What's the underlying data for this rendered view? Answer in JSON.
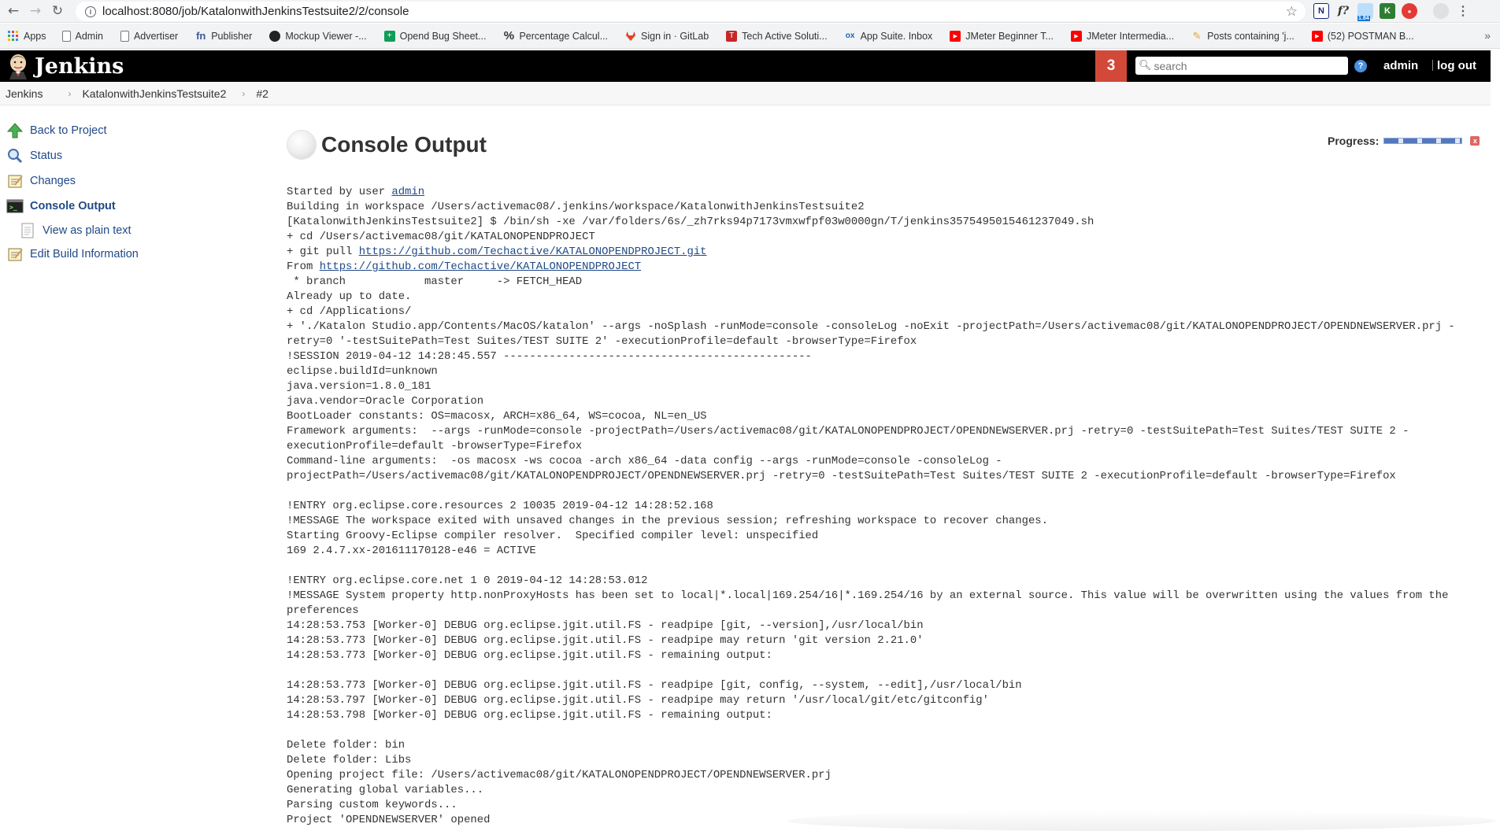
{
  "browser": {
    "url": "localhost:8080/job/KatalonwithJenkinsTestsuite2/2/console",
    "ext_badge": "1.84",
    "bookmarks": [
      {
        "label": "Apps",
        "icon": "apps-grid-icon",
        "color": "#4285f4"
      },
      {
        "label": "Admin",
        "icon": "page-icon",
        "color": "#9e9e9e"
      },
      {
        "label": "Advertiser",
        "icon": "page-icon",
        "color": "#9e9e9e"
      },
      {
        "label": "Publisher",
        "icon": "fn-icon",
        "color": "#3b5998"
      },
      {
        "label": "Mockup Viewer -...",
        "icon": "mockup-icon",
        "color": "#222222"
      },
      {
        "label": "Opend Bug Sheet...",
        "icon": "sheets-icon",
        "color": "#0f9d58"
      },
      {
        "label": "Percentage Calcul...",
        "icon": "percent-icon",
        "color": "#333333"
      },
      {
        "label": "Sign in · GitLab",
        "icon": "gitlab-icon",
        "color": "#e24329"
      },
      {
        "label": "Tech Active Soluti...",
        "icon": "techactive-icon",
        "color": "#c62828"
      },
      {
        "label": "App Suite. Inbox",
        "icon": "ox-icon",
        "color": "#1565c0"
      },
      {
        "label": "JMeter Beginner T...",
        "icon": "youtube-icon",
        "color": "#ff0000"
      },
      {
        "label": "JMeter Intermedia...",
        "icon": "youtube-icon",
        "color": "#ff0000"
      },
      {
        "label": "Posts containing 'j...",
        "icon": "posts-icon",
        "color": "#e8a33a"
      },
      {
        "label": "(52) POSTMAN B...",
        "icon": "youtube-icon",
        "color": "#ff0000"
      }
    ],
    "more": "»"
  },
  "header": {
    "title": "Jenkins",
    "notification_count": "3",
    "search_placeholder": "search",
    "help": "?",
    "user": "admin",
    "logout": "log out"
  },
  "breadcrumb": [
    "Jenkins",
    "KatalonwithJenkinsTestsuite2",
    "#2"
  ],
  "sidebar": [
    {
      "label": "Back to Project",
      "icon": "up-arrow-icon"
    },
    {
      "label": "Status",
      "icon": "magnifier-icon"
    },
    {
      "label": "Changes",
      "icon": "notepad-icon"
    },
    {
      "label": "Console Output",
      "icon": "terminal-icon",
      "active": true
    },
    {
      "label": "View as plain text",
      "icon": "document-icon",
      "sub": true
    },
    {
      "label": "Edit Build Information",
      "icon": "notepad-icon"
    }
  ],
  "main": {
    "title": "Console Output",
    "progress_label": "Progress:",
    "stop": "x"
  },
  "console": {
    "started_by": "Started by user ",
    "started_user": "admin",
    "lines_a": [
      "Building in workspace /Users/activemac08/.jenkins/workspace/KatalonwithJenkinsTestsuite2",
      "[KatalonwithJenkinsTestsuite2] $ /bin/sh -xe /var/folders/6s/_zh7rks94p7173vmxwfpf03w0000gn/T/jenkins3575495015461237049.sh",
      "+ cd /Users/activemac08/git/KATALONOPENDPROJECT"
    ],
    "git_pull_prefix": "+ git pull ",
    "git_pull_url": "https://github.com/Techactive/KATALONOPENDPROJECT.git",
    "from_prefix": "From ",
    "from_url": "https://github.com/Techactive/KATALONOPENDPROJECT",
    "lines_b": [
      " * branch            master     -> FETCH_HEAD",
      "Already up to date.",
      "+ cd /Applications/",
      "+ './Katalon Studio.app/Contents/MacOS/katalon' --args -noSplash -runMode=console -consoleLog -noExit -projectPath=/Users/activemac08/git/KATALONOPENDPROJECT/OPENDNEWSERVER.prj -",
      "retry=0 '-testSuitePath=Test Suites/TEST SUITE 2' -executionProfile=default -browserType=Firefox",
      "!SESSION 2019-04-12 14:28:45.557 -----------------------------------------------",
      "eclipse.buildId=unknown",
      "java.version=1.8.0_181",
      "java.vendor=Oracle Corporation",
      "BootLoader constants: OS=macosx, ARCH=x86_64, WS=cocoa, NL=en_US",
      "Framework arguments:  --args -runMode=console -projectPath=/Users/activemac08/git/KATALONOPENDPROJECT/OPENDNEWSERVER.prj -retry=0 -testSuitePath=Test Suites/TEST SUITE 2 -",
      "executionProfile=default -browserType=Firefox",
      "Command-line arguments:  -os macosx -ws cocoa -arch x86_64 -data config --args -runMode=console -consoleLog -",
      "projectPath=/Users/activemac08/git/KATALONOPENDPROJECT/OPENDNEWSERVER.prj -retry=0 -testSuitePath=Test Suites/TEST SUITE 2 -executionProfile=default -browserType=Firefox",
      "",
      "!ENTRY org.eclipse.core.resources 2 10035 2019-04-12 14:28:52.168",
      "!MESSAGE The workspace exited with unsaved changes in the previous session; refreshing workspace to recover changes.",
      "Starting Groovy-Eclipse compiler resolver.  Specified compiler level: unspecified",
      "169 2.4.7.xx-201611170128-e46 = ACTIVE",
      "",
      "!ENTRY org.eclipse.core.net 1 0 2019-04-12 14:28:53.012",
      "!MESSAGE System property http.nonProxyHosts has been set to local|*.local|169.254/16|*.169.254/16 by an external source. This value will be overwritten using the values from the",
      "preferences",
      "14:28:53.753 [Worker-0] DEBUG org.eclipse.jgit.util.FS - readpipe [git, --version],/usr/local/bin",
      "14:28:53.773 [Worker-0] DEBUG org.eclipse.jgit.util.FS - readpipe may return 'git version 2.21.0'",
      "14:28:53.773 [Worker-0] DEBUG org.eclipse.jgit.util.FS - remaining output:",
      "",
      "14:28:53.773 [Worker-0] DEBUG org.eclipse.jgit.util.FS - readpipe [git, config, --system, --edit],/usr/local/bin",
      "14:28:53.797 [Worker-0] DEBUG org.eclipse.jgit.util.FS - readpipe may return '/usr/local/git/etc/gitconfig'",
      "14:28:53.798 [Worker-0] DEBUG org.eclipse.jgit.util.FS - remaining output:",
      "",
      "Delete folder: bin",
      "Delete folder: Libs",
      "Opening project file: /Users/activemac08/git/KATALONOPENDPROJECT/OPENDNEWSERVER.prj",
      "Generating global variables...",
      "Parsing custom keywords...",
      "Project 'OPENDNEWSERVER' opened"
    ]
  }
}
